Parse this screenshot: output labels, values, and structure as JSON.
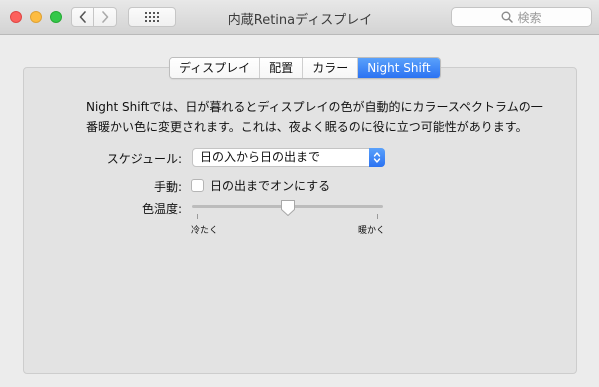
{
  "window": {
    "title": "内蔵Retinaディスプレイ"
  },
  "toolbar": {
    "back_icon": "chevron-left-icon",
    "forward_icon": "chevron-right-icon",
    "grid_icon": "grid-icon",
    "search_placeholder": "検索"
  },
  "tabs": [
    {
      "label": "ディスプレイ",
      "active": false
    },
    {
      "label": "配置",
      "active": false
    },
    {
      "label": "カラー",
      "active": false
    },
    {
      "label": "Night Shift",
      "active": true
    }
  ],
  "content": {
    "description": "Night Shiftでは、日が暮れるとディスプレイの色が自動的にカラースペクトラムの一番暖かい色に変更されます。これは、夜よく眠るのに役に立つ可能性があります。",
    "schedule_label": "スケジュール:",
    "schedule_value": "日の入から日の出まで",
    "manual_label": "手動:",
    "manual_option": "日の出までオンにする",
    "manual_checked": false,
    "temperature_label": "色温度:",
    "temperature_min_label": "冷たく",
    "temperature_max_label": "暖かく",
    "temperature_value_fraction": 0.5
  },
  "colors": {
    "accent": "#2b72f2",
    "close": "#fc605c",
    "minimize": "#fdbc40",
    "maximize": "#34c84a"
  }
}
